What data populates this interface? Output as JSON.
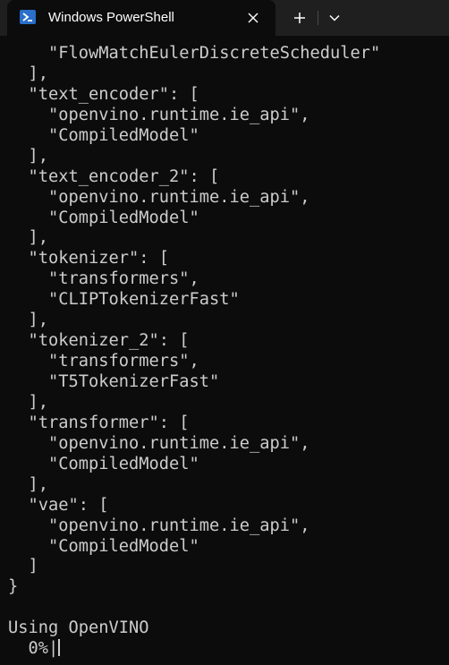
{
  "window": {
    "tab_title": "Windows PowerShell",
    "tab_icon": "powershell-icon",
    "close_icon": "close-icon",
    "new_tab_icon": "plus-icon",
    "dropdown_icon": "chevron-down-icon",
    "tab_bar_color": "#1f1f1f",
    "background_color": "#0c0c0c",
    "text_color": "#cccccc"
  },
  "terminal": {
    "lines": [
      "    \"FlowMatchEulerDiscreteScheduler\"",
      "  ],",
      "  \"text_encoder\": [",
      "    \"openvino.runtime.ie_api\",",
      "    \"CompiledModel\"",
      "  ],",
      "  \"text_encoder_2\": [",
      "    \"openvino.runtime.ie_api\",",
      "    \"CompiledModel\"",
      "  ],",
      "  \"tokenizer\": [",
      "    \"transformers\",",
      "    \"CLIPTokenizerFast\"",
      "  ],",
      "  \"tokenizer_2\": [",
      "    \"transformers\",",
      "    \"T5TokenizerFast\"",
      "  ],",
      "  \"transformer\": [",
      "    \"openvino.runtime.ie_api\",",
      "    \"CompiledModel\"",
      "  ],",
      "  \"vae\": [",
      "    \"openvino.runtime.ie_api\",",
      "    \"CompiledModel\"",
      "  ]",
      "}",
      "",
      "Using OpenVINO",
      "  0%|"
    ]
  }
}
